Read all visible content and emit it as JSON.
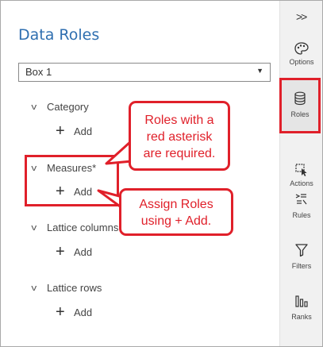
{
  "panel": {
    "title": "Data Roles",
    "dropdown_value": "Box 1"
  },
  "roles": [
    {
      "label": "Category",
      "add_label": "Add"
    },
    {
      "label": "Measures*",
      "add_label": "Add"
    },
    {
      "label": "Lattice columns",
      "add_label": "Add"
    },
    {
      "label": "Lattice rows",
      "add_label": "Add"
    }
  ],
  "callouts": {
    "required": [
      "Roles with a",
      "red asterisk",
      "are required."
    ],
    "assign": [
      "Assign Roles",
      "using + Add."
    ]
  },
  "rail": {
    "collapse_glyph": ">>",
    "items": [
      {
        "label": "Options",
        "icon": "palette-icon"
      },
      {
        "label": "Roles",
        "icon": "database-icon"
      },
      {
        "label": "Actions",
        "icon": "cursor-select-icon"
      },
      {
        "label": "Rules",
        "icon": "rules-icon"
      },
      {
        "label": "Filters",
        "icon": "filter-icon"
      },
      {
        "label": "Ranks",
        "icon": "ranks-icon"
      }
    ]
  },
  "colors": {
    "accent_red": "#e0202a",
    "title_blue": "#2f6fb0"
  }
}
